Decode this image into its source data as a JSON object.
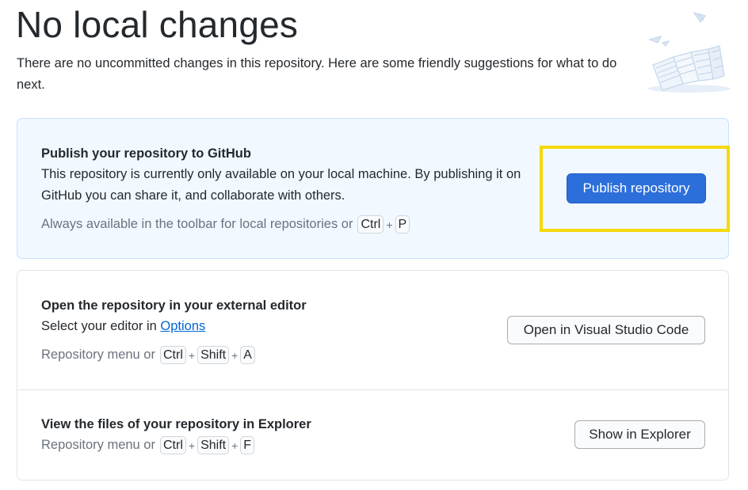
{
  "header": {
    "title": "No local changes",
    "subtitle": "There are no uncommitted changes in this repository. Here are some friendly suggestions for what to do next."
  },
  "illustration": {
    "icon": "paper-stack-illustration-icon"
  },
  "publish": {
    "title": "Publish your repository to GitHub",
    "description": "This repository is currently only available on your local machine. By publishing it on GitHub you can share it, and collaborate with others.",
    "shortcut_prefix": "Always available in the toolbar for local repositories or",
    "keys": [
      "Ctrl",
      "P"
    ],
    "button_label": "Publish repository"
  },
  "editor": {
    "title": "Open the repository in your external editor",
    "description_prefix": "Select your editor in",
    "options_link": "Options",
    "shortcut_prefix": "Repository menu or",
    "keys": [
      "Ctrl",
      "Shift",
      "A"
    ],
    "button_label": "Open in Visual Studio Code"
  },
  "explorer": {
    "title": "View the files of your repository in Explorer",
    "shortcut_prefix": "Repository menu or",
    "keys": [
      "Ctrl",
      "Shift",
      "F"
    ],
    "button_label": "Show in Explorer"
  },
  "colors": {
    "primary_button": "#2c6fda",
    "highlight_card": "#f1f8ff",
    "focus_outline": "#f5d90c",
    "link": "#0366d6"
  }
}
